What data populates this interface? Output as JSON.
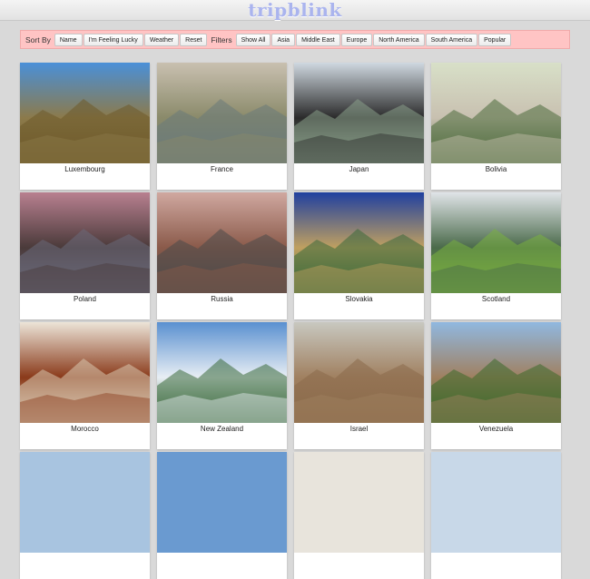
{
  "app": {
    "title": "tripblink"
  },
  "toolbar": {
    "sort_label": "Sort By",
    "sort_buttons": [
      "Name",
      "I'm Feeling Lucky",
      "Weather",
      "Reset"
    ],
    "filters_label": "Filters",
    "filter_buttons": [
      "Show All",
      "Asia",
      "Middle East",
      "Europe",
      "North America",
      "South America",
      "Popular"
    ]
  },
  "destinations": [
    {
      "name": "Luxembourg",
      "sky": "#4a90d8",
      "mid": "#8c7a4a",
      "ground": "#6e5a2a"
    },
    {
      "name": "France",
      "sky": "#c9c0b0",
      "mid": "#8a8a6a",
      "ground": "#6a7a7a"
    },
    {
      "name": "Japan",
      "sky": "#cfd8e0",
      "mid": "#2a2a2a",
      "ground": "#8aa08a"
    },
    {
      "name": "Bolivia",
      "sky": "#d8e0c8",
      "mid": "#c8c0b0",
      "ground": "#4a6a3a"
    },
    {
      "name": "Poland",
      "sky": "#b88090",
      "mid": "#4a3a3a",
      "ground": "#6a6a7a"
    },
    {
      "name": "Russia",
      "sky": "#d0a8a0",
      "mid": "#8a5a4a",
      "ground": "#4a4a4a"
    },
    {
      "name": "Slovakia",
      "sky": "#2040a0",
      "mid": "#c0a060",
      "ground": "#3a6a3a"
    },
    {
      "name": "Scotland",
      "sky": "#e0e4e8",
      "mid": "#4a6a4a",
      "ground": "#7ab040"
    },
    {
      "name": "Morocco",
      "sky": "#ece4d8",
      "mid": "#8a3a1a",
      "ground": "#d8c8b0"
    },
    {
      "name": "New Zealand",
      "sky": "#5a90d0",
      "mid": "#e8eef4",
      "ground": "#3a6a3a"
    },
    {
      "name": "Israel",
      "sky": "#c8c8c0",
      "mid": "#a08060",
      "ground": "#8a6a4a"
    },
    {
      "name": "Venezuela",
      "sky": "#90b8e0",
      "mid": "#a08060",
      "ground": "#3a6a2a"
    }
  ]
}
